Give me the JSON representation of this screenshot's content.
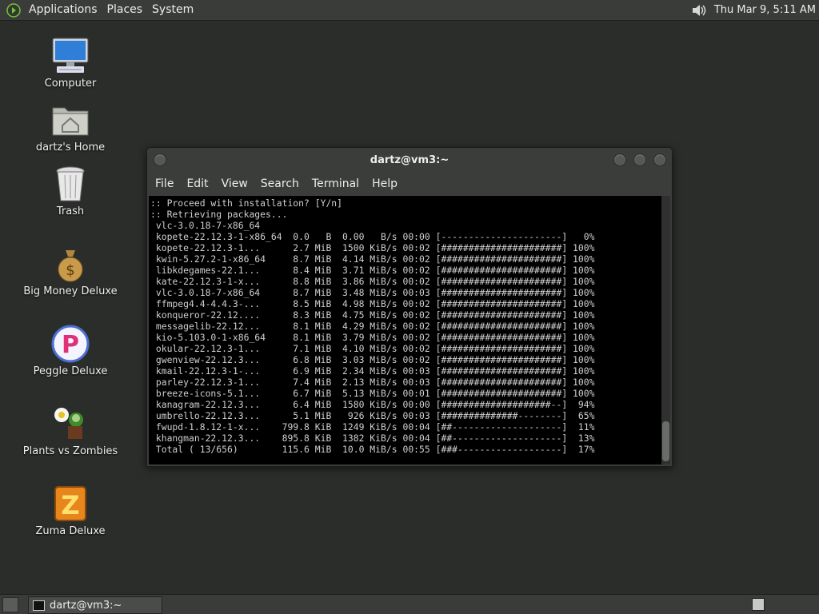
{
  "top_panel": {
    "menus": [
      "Applications",
      "Places",
      "System"
    ],
    "clock": "Thu Mar  9,  5:11 AM"
  },
  "desktop_icons": [
    "Computer",
    "dartz's Home",
    "Trash",
    "Big Money Deluxe",
    "Peggle Deluxe",
    "Plants vs Zombies",
    "Zuma Deluxe"
  ],
  "window": {
    "title": "dartz@vm3:~",
    "menus": [
      "File",
      "Edit",
      "View",
      "Search",
      "Terminal",
      "Help"
    ]
  },
  "terminal_lines": [
    ":: Proceed with installation? [Y/n]",
    ":: Retrieving packages...",
    " vlc-3.0.18-7-x86_64",
    " kopete-22.12.3-1-x86_64  0.0   B  0.00   B/s 00:00 [----------------------]   0%",
    " kopete-22.12.3-1...      2.7 MiB  1500 KiB/s 00:02 [######################] 100%",
    " kwin-5.27.2-1-x86_64     8.7 MiB  4.14 MiB/s 00:02 [######################] 100%",
    " libkdegames-22.1...      8.4 MiB  3.71 MiB/s 00:02 [######################] 100%",
    " kate-22.12.3-1-x...      8.8 MiB  3.86 MiB/s 00:02 [######################] 100%",
    " vlc-3.0.18-7-x86_64      8.7 MiB  3.48 MiB/s 00:03 [######################] 100%",
    " ffmpeg4.4-4.4.3-...      8.5 MiB  4.98 MiB/s 00:02 [######################] 100%",
    " konqueror-22.12....      8.3 MiB  4.75 MiB/s 00:02 [######################] 100%",
    " messagelib-22.12...      8.1 MiB  4.29 MiB/s 00:02 [######################] 100%",
    " kio-5.103.0-1-x86_64     8.1 MiB  3.79 MiB/s 00:02 [######################] 100%",
    " okular-22.12.3-1...      7.1 MiB  4.10 MiB/s 00:02 [######################] 100%",
    " gwenview-22.12.3...      6.8 MiB  3.03 MiB/s 00:02 [######################] 100%",
    " kmail-22.12.3-1-...      6.9 MiB  2.34 MiB/s 00:03 [######################] 100%",
    " parley-22.12.3-1...      7.4 MiB  2.13 MiB/s 00:03 [######################] 100%",
    " breeze-icons-5.1...      6.7 MiB  5.13 MiB/s 00:01 [######################] 100%",
    " kanagram-22.12.3...      6.4 MiB  1580 KiB/s 00:00 [####################--]  94%",
    " umbrello-22.12.3...      5.1 MiB   926 KiB/s 00:03 [##############--------]  65%",
    " fwupd-1.8.12-1-x...    799.8 KiB  1249 KiB/s 00:04 [##--------------------]  11%",
    " khangman-22.12.3...    895.8 KiB  1382 KiB/s 00:04 [##--------------------]  13%",
    " Total ( 13/656)        115.6 MiB  10.0 MiB/s 00:55 [###-------------------]  17%"
  ],
  "taskbar": {
    "task_label": "dartz@vm3:~"
  }
}
